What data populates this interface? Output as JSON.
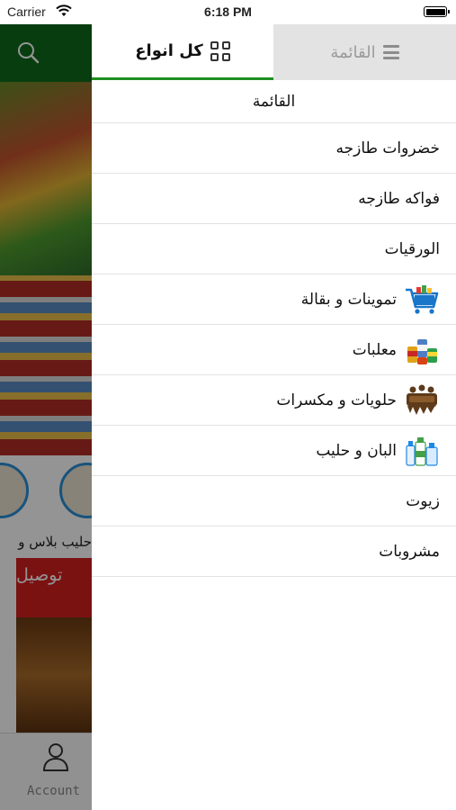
{
  "status_bar": {
    "carrier": "Carrier",
    "time": "6:18 PM"
  },
  "background_app": {
    "category_label": "حليب بلاس و",
    "red_banner_text": "توصيل",
    "tab_account_label": "Account",
    "header_color": "#0f6b1b"
  },
  "drawer": {
    "tabs": [
      {
        "label": "كل انواع",
        "icon": "grid-icon",
        "active": true
      },
      {
        "label": "القائمة",
        "icon": "hamburger-icon",
        "active": false
      }
    ],
    "menu_title": "القائمة",
    "items": [
      {
        "label": "خضروات طازجه",
        "icon": null
      },
      {
        "label": "فواكه طازجه",
        "icon": null
      },
      {
        "label": "الورقيات",
        "icon": null
      },
      {
        "label": "تموينات و بقالة",
        "icon": "shopping-cart-icon"
      },
      {
        "label": "معلبات",
        "icon": "canned-goods-icon"
      },
      {
        "label": "حلويات و مكسرات",
        "icon": "chocolate-icon"
      },
      {
        "label": "البان و حليب",
        "icon": "milk-bottles-icon"
      },
      {
        "label": "زيوت",
        "icon": null
      },
      {
        "label": "مشروبات",
        "icon": null
      }
    ],
    "colors": {
      "active_tab_underline": "#1f8f22",
      "inactive_tab_bg": "#e3e3e3",
      "divider": "#e2e2e2"
    }
  }
}
